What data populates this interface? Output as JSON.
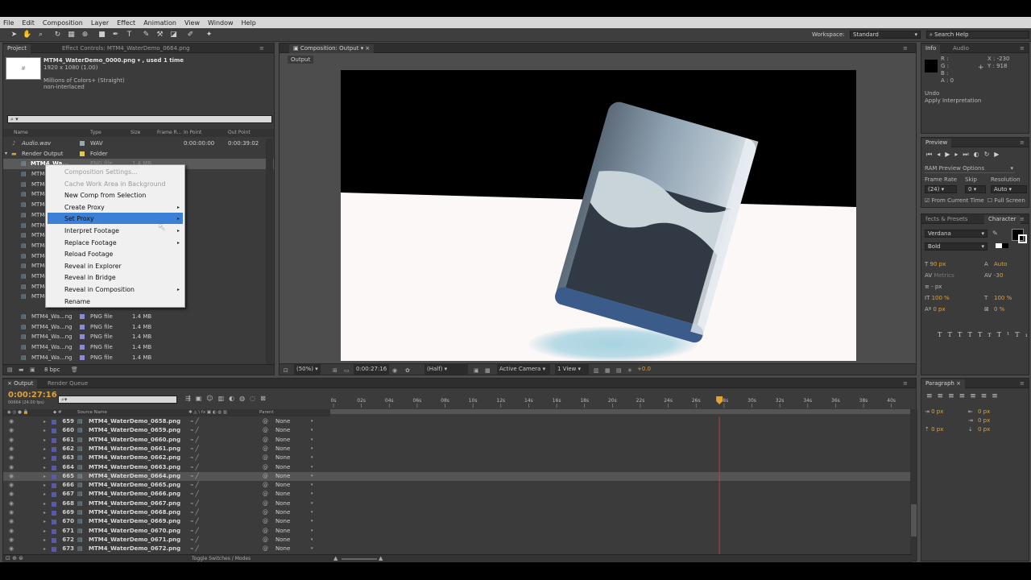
{
  "menubar": [
    "File",
    "Edit",
    "Composition",
    "Layer",
    "Effect",
    "Animation",
    "View",
    "Window",
    "Help"
  ],
  "toolbar": {
    "workspace_label": "Workspace:",
    "workspace_value": "Standard",
    "search_placeholder": "Search Help"
  },
  "project": {
    "tab_project": "Project",
    "tab_effects": "Effect Controls: MTM4_WaterDemo_0664.png",
    "item_name": "MTM4_WaterDemo_0000.png ▾ , used 1 time",
    "item_size": "1920 x 1080 (1.00)",
    "item_colors": "Millions of Colors+ (Straight)",
    "item_interlace": "non-interlaced",
    "search_value": "",
    "columns": {
      "name": "Name",
      "type": "Type",
      "size": "Size",
      "framerate": "Frame R...",
      "in": "In Point",
      "out": "Out Point"
    },
    "audio_row": {
      "name": "Audio.wav",
      "type": "WAV",
      "in": "0:00:00:00",
      "out": "0:00:39:02"
    },
    "folder_row": {
      "name": "Render Output",
      "type": "Folder"
    },
    "highlight_row": {
      "name": "MTM4_Wa...",
      "type": "PNG file",
      "size": "1.4 MB"
    },
    "partial_rows": [
      "MTM4",
      "MTM4",
      "MTM4",
      "MTM4",
      "MTM4",
      "MTM4",
      "MTM4",
      "MTM4",
      "MTM4",
      "MTM4",
      "MTM4",
      "MTM4",
      "MTM4"
    ],
    "file_rows": [
      {
        "name": "MTM4_Wa...ng",
        "type": "PNG file",
        "size": "1.4 MB"
      },
      {
        "name": "MTM4_Wa...ng",
        "type": "PNG file",
        "size": "1.4 MB"
      },
      {
        "name": "MTM4_Wa...ng",
        "type": "PNG file",
        "size": "1.4 MB"
      },
      {
        "name": "MTM4_Wa...ng",
        "type": "PNG file",
        "size": "1.4 MB"
      },
      {
        "name": "MTM4_Wa...ng",
        "type": "PNG file",
        "size": "1.4 MB"
      }
    ],
    "footer_bpc": "8 bpc"
  },
  "context_menu": [
    {
      "label": "Composition Settings...",
      "disabled": true,
      "submenu": false
    },
    {
      "label": "Cache Work Area in Background",
      "disabled": true,
      "submenu": false
    },
    {
      "label": "New Comp from Selection",
      "disabled": false,
      "submenu": false
    },
    {
      "label": "Create Proxy",
      "disabled": false,
      "submenu": true
    },
    {
      "label": "Set Proxy",
      "disabled": false,
      "submenu": true
    },
    {
      "label": "Interpret Footage",
      "disabled": false,
      "submenu": true
    },
    {
      "label": "Replace Footage",
      "disabled": false,
      "submenu": true
    },
    {
      "label": "Reload Footage",
      "disabled": false,
      "submenu": false
    },
    {
      "label": "Reveal in Explorer",
      "disabled": false,
      "submenu": false
    },
    {
      "label": "Reveal in Bridge",
      "disabled": false,
      "submenu": false
    },
    {
      "label": "Reveal in Composition",
      "disabled": false,
      "submenu": true
    },
    {
      "label": "Rename",
      "disabled": false,
      "submenu": false
    }
  ],
  "composition": {
    "tab": "Composition: Output",
    "subtab": "Output",
    "footer": {
      "zoom": "(50%)",
      "timecode": "0:00:27:16",
      "resolution": "(Half)",
      "camera": "Active Camera",
      "view": "1 View",
      "exposure": "+0.0"
    }
  },
  "info": {
    "tab_info": "Info",
    "tab_audio": "Audio",
    "r": "R :",
    "g": "G :",
    "b": "B :",
    "a": "A : 0",
    "x": "X : -230",
    "y": "Y : 918",
    "undo_label": "Undo",
    "undo_action": "Apply Interpretation"
  },
  "preview": {
    "tab": "Preview",
    "ram_options": "RAM Preview Options",
    "frame_rate_label": "Frame Rate",
    "skip_label": "Skip",
    "resolution_label": "Resolution",
    "frame_rate_value": "(24)",
    "skip_value": "0",
    "resolution_value": "Auto",
    "from_current": "From Current Time",
    "full_screen": "Full Screen"
  },
  "character": {
    "tab_effects": "fects & Presets",
    "tab_character": "Character",
    "font": "Verdana",
    "style": "Bold",
    "size": "90 px",
    "leading": "Auto",
    "kerning": "Metrics",
    "tracking": "-30",
    "stroke": "- px",
    "vscale": "100 %",
    "hscale": "100 %",
    "baseline": "0 px",
    "tsume": "0 %",
    "color_fill": "#000000",
    "color_stroke": "#ffffff"
  },
  "paragraph": {
    "tab": "Paragraph",
    "indent1": "0 px",
    "indent2": "0 px",
    "indent3": "0 px",
    "space1": "0 px",
    "space2": "0 px"
  },
  "timeline": {
    "tab_output": "Output",
    "tab_render": "Render Queue",
    "timecode": "0:00:27:16",
    "timecode_sub": "00664 (24.00 fps)",
    "search_value": "",
    "col_source": "Source Name",
    "col_parent": "Parent",
    "ruler": [
      "0s",
      "02s",
      "04s",
      "06s",
      "08s",
      "10s",
      "12s",
      "14s",
      "16s",
      "18s",
      "20s",
      "22s",
      "24s",
      "26s",
      "28s",
      "30s",
      "32s",
      "34s",
      "36s",
      "38s",
      "40s"
    ],
    "playhead_value": "27.67",
    "layers": [
      {
        "num": "659",
        "name": "MTM4_WaterDemo_0658.png",
        "parent": "None"
      },
      {
        "num": "660",
        "name": "MTM4_WaterDemo_0659.png",
        "parent": "None"
      },
      {
        "num": "661",
        "name": "MTM4_WaterDemo_0660.png",
        "parent": "None"
      },
      {
        "num": "662",
        "name": "MTM4_WaterDemo_0661.png",
        "parent": "None"
      },
      {
        "num": "663",
        "name": "MTM4_WaterDemo_0662.png",
        "parent": "None"
      },
      {
        "num": "664",
        "name": "MTM4_WaterDemo_0663.png",
        "parent": "None"
      },
      {
        "num": "665",
        "name": "MTM4_WaterDemo_0664.png",
        "parent": "None"
      },
      {
        "num": "666",
        "name": "MTM4_WaterDemo_0665.png",
        "parent": "None"
      },
      {
        "num": "667",
        "name": "MTM4_WaterDemo_0666.png",
        "parent": "None"
      },
      {
        "num": "668",
        "name": "MTM4_WaterDemo_0667.png",
        "parent": "None"
      },
      {
        "num": "669",
        "name": "MTM4_WaterDemo_0668.png",
        "parent": "None"
      },
      {
        "num": "670",
        "name": "MTM4_WaterDemo_0669.png",
        "parent": "None"
      },
      {
        "num": "671",
        "name": "MTM4_WaterDemo_0670.png",
        "parent": "None"
      },
      {
        "num": "672",
        "name": "MTM4_WaterDemo_0671.png",
        "parent": "None"
      },
      {
        "num": "673",
        "name": "MTM4_WaterDemo_0672.png",
        "parent": "None"
      }
    ],
    "toggle_label": "Toggle Switches / Modes"
  }
}
